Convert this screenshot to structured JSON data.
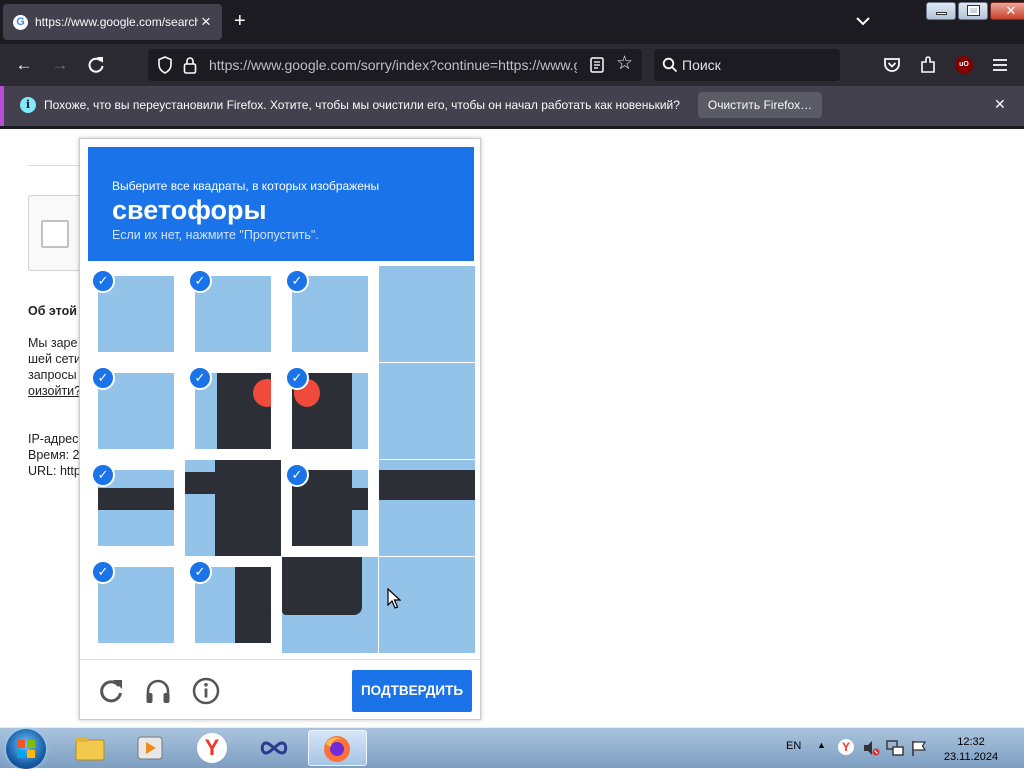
{
  "tab": {
    "title": "https://www.google.com/search",
    "favicon": "G"
  },
  "navbar": {
    "url": "https://www.google.com/sorry/index?continue=https://www.google.com",
    "search_placeholder": "Поиск",
    "ext_badge": "uO"
  },
  "infobar": {
    "message": "Похоже, что вы переустановили Firefox. Хотите, чтобы мы очистили его, чтобы он начал работать как новенький?",
    "button": "Очистить Firefox…"
  },
  "page": {
    "about": "Об этой",
    "p1": "Мы заре",
    "p2": "шей сети",
    "p3": "запросы",
    "link": "оизойти?",
    "ip": "IP-адрес",
    "time": "Время: 2",
    "url": "URL: http"
  },
  "captcha": {
    "line1": "Выберите все квадраты, в которых изображены",
    "keyword": "светофоры",
    "line3": "Если их нет, нажмите \"Пропустить\".",
    "verify": "ПОДТВЕРДИТЬ",
    "tiles_selected": [
      true,
      true,
      true,
      false,
      true,
      true,
      true,
      false,
      true,
      false,
      true,
      false,
      true,
      true,
      false,
      false
    ]
  },
  "taskbar": {
    "lang": "EN",
    "time": "12:32",
    "date": "23.11.2024"
  },
  "colors": {
    "accent": "#1a73e8",
    "sky": "#93c3e9",
    "pole": "#2c3036"
  }
}
